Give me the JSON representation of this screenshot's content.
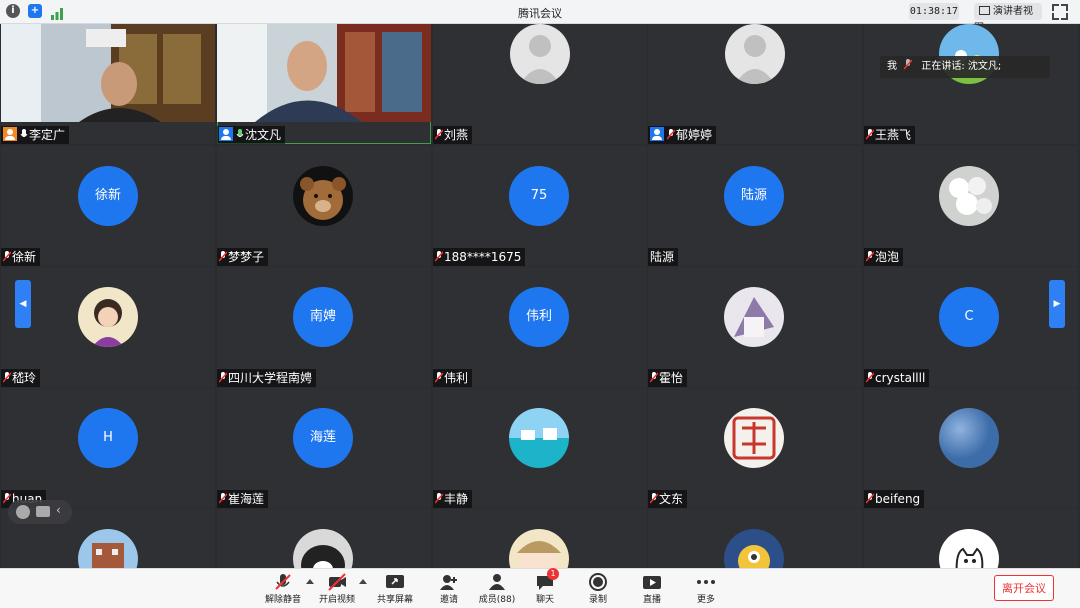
{
  "app": {
    "title": "腾讯会议",
    "timer": "01:38:17",
    "speaker_view_label": "演讲者视图"
  },
  "speaking": {
    "me_label": "我",
    "now_speaking": "正在讲话: 沈文凡;"
  },
  "participants": [
    {
      "name": "李定广",
      "type": "video"
    },
    {
      "name": "沈文凡",
      "type": "video"
    },
    {
      "name": "刘燕",
      "type": "photo"
    },
    {
      "name": "郁婷婷",
      "type": "photo"
    },
    {
      "name": "王燕飞",
      "type": "photo"
    },
    {
      "name": "徐新",
      "type": "initial",
      "avatar_text": "徐新"
    },
    {
      "name": "梦梦子",
      "type": "photo"
    },
    {
      "name": "188****1675",
      "type": "initial",
      "avatar_text": "75"
    },
    {
      "name": "陆源",
      "type": "initial",
      "avatar_text": "陆源"
    },
    {
      "name": "泡泡",
      "type": "photo"
    },
    {
      "name": "嵇玲",
      "type": "photo"
    },
    {
      "name": "四川大学程南娉",
      "type": "initial",
      "avatar_text": "南娉"
    },
    {
      "name": "伟利",
      "type": "initial",
      "avatar_text": "伟利"
    },
    {
      "name": "霍怡",
      "type": "photo"
    },
    {
      "name": "crystallll",
      "type": "initial",
      "avatar_text": "C"
    },
    {
      "name": "huan",
      "type": "initial",
      "avatar_text": "H"
    },
    {
      "name": "崔海莲",
      "type": "initial",
      "avatar_text": "海莲"
    },
    {
      "name": "丰静",
      "type": "photo"
    },
    {
      "name": "文东",
      "type": "photo"
    },
    {
      "name": "beifeng",
      "type": "photo"
    }
  ],
  "toolbar": {
    "unmute": "解除静音",
    "start_video": "开启视频",
    "share_screen": "共享屏幕",
    "invite": "邀请",
    "members": "成员(88)",
    "chat": "聊天",
    "chat_badge": "1",
    "record": "录制",
    "live": "直播",
    "more": "更多",
    "leave": "离开会议"
  },
  "colors": {
    "accent": "#1f77f0",
    "danger": "#e33333",
    "active_border": "#3ca24a"
  }
}
